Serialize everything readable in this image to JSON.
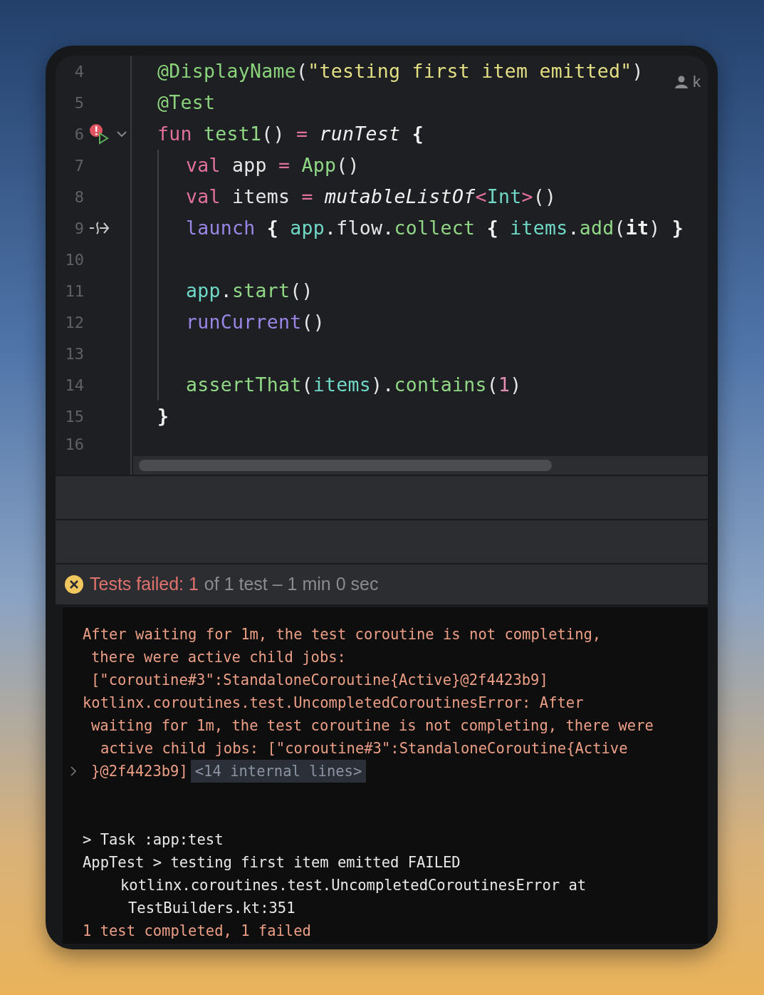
{
  "editor": {
    "author_hint": "k",
    "lines": [
      {
        "number": "4",
        "indented": false,
        "foldable": false,
        "tokens": [
          {
            "text": "@DisplayName",
            "kind": "annotation"
          },
          {
            "text": "(",
            "kind": "plain"
          },
          {
            "text": "\"testing first item emitted\"",
            "kind": "string"
          },
          {
            "text": ")",
            "kind": "plain"
          }
        ]
      },
      {
        "number": "5",
        "indented": false,
        "foldable": false,
        "tokens": [
          {
            "text": "@Test",
            "kind": "annotation"
          }
        ]
      },
      {
        "number": "6",
        "indented": false,
        "gutter_icon": {
          "kind": "failed_run"
        },
        "foldable": true,
        "tokens": [
          {
            "text": "fun ",
            "kind": "keyword"
          },
          {
            "text": "test1",
            "kind": "call"
          },
          {
            "text": "() ",
            "kind": "plain"
          },
          {
            "text": "= ",
            "kind": "keyword"
          },
          {
            "text": "runTest",
            "kind": "italic"
          },
          {
            "text": " {",
            "kind": "bold"
          }
        ]
      },
      {
        "number": "7",
        "indented": true,
        "foldable": false,
        "tokens": [
          {
            "text": "val ",
            "kind": "keyword"
          },
          {
            "text": "app ",
            "kind": "plain"
          },
          {
            "text": "= ",
            "kind": "keyword"
          },
          {
            "text": "App",
            "kind": "call"
          },
          {
            "text": "()",
            "kind": "plain"
          }
        ]
      },
      {
        "number": "8",
        "indented": true,
        "foldable": false,
        "tokens": [
          {
            "text": "val ",
            "kind": "keyword"
          },
          {
            "text": "items ",
            "kind": "plain"
          },
          {
            "text": "= ",
            "kind": "keyword"
          },
          {
            "text": "mutableListOf",
            "kind": "italic"
          },
          {
            "text": "<",
            "kind": "keyword"
          },
          {
            "text": "Int",
            "kind": "variable"
          },
          {
            "text": ">",
            "kind": "keyword"
          },
          {
            "text": "()",
            "kind": "plain"
          }
        ]
      },
      {
        "number": "9",
        "indented": true,
        "gutter_icon": {
          "kind": "suspend_call"
        },
        "foldable": false,
        "tokens": [
          {
            "text": "launch",
            "kind": "builtin"
          },
          {
            "text": " { ",
            "kind": "bold"
          },
          {
            "text": "app",
            "kind": "variable"
          },
          {
            "text": ".flow.",
            "kind": "plain"
          },
          {
            "text": "collect",
            "kind": "call"
          },
          {
            "text": " { ",
            "kind": "bold"
          },
          {
            "text": "items",
            "kind": "variable"
          },
          {
            "text": ".",
            "kind": "plain"
          },
          {
            "text": "add",
            "kind": "call"
          },
          {
            "text": "(",
            "kind": "plain"
          },
          {
            "text": "it",
            "kind": "bold"
          },
          {
            "text": ") ",
            "kind": "plain"
          },
          {
            "text": "}",
            "kind": "bold"
          }
        ]
      },
      {
        "number": "10",
        "indented": true,
        "foldable": false
      },
      {
        "number": "11",
        "indented": true,
        "foldable": false,
        "tokens": [
          {
            "text": "app",
            "kind": "variable"
          },
          {
            "text": ".",
            "kind": "plain"
          },
          {
            "text": "start",
            "kind": "call"
          },
          {
            "text": "()",
            "kind": "plain"
          }
        ]
      },
      {
        "number": "12",
        "indented": true,
        "foldable": false,
        "tokens": [
          {
            "text": "runCurrent",
            "kind": "builtin"
          },
          {
            "text": "()",
            "kind": "plain"
          }
        ]
      },
      {
        "number": "13",
        "indented": true,
        "foldable": false
      },
      {
        "number": "14",
        "indented": true,
        "foldable": false,
        "tokens": [
          {
            "text": "assertThat",
            "kind": "call"
          },
          {
            "text": "(",
            "kind": "plain"
          },
          {
            "text": "items",
            "kind": "variable"
          },
          {
            "text": ").",
            "kind": "plain"
          },
          {
            "text": "contains",
            "kind": "call"
          },
          {
            "text": "(",
            "kind": "plain"
          },
          {
            "text": "1",
            "kind": "number"
          },
          {
            "text": ")",
            "kind": "plain"
          }
        ]
      },
      {
        "number": "15",
        "indented": false,
        "foldable": false,
        "tokens": [
          {
            "text": "}",
            "kind": "bold"
          }
        ]
      },
      {
        "number": "16",
        "indented": false,
        "foldable": false
      }
    ]
  },
  "test_results": {
    "kind": "failed",
    "status_label": "Tests failed: 1",
    "detail": "of 1 test – 1 min 0 sec"
  },
  "console": {
    "lines": [
      {
        "text": "After waiting for 1m, the test coroutine is not completing,",
        "kind": "error"
      },
      {
        "text": "there were active child jobs:",
        "kind": "error_wrap"
      },
      {
        "text": "[\"coroutine#3\":StandaloneCoroutine{Active}@2f4423b9]",
        "kind": "error_wrap"
      },
      {
        "text": "kotlinx.coroutines.test.UncompletedCoroutinesError: After",
        "kind": "error"
      },
      {
        "text": "waiting for 1m, the test coroutine is not completing, there were",
        "kind": "error_wrap"
      },
      {
        "text": "active child jobs: [\"coroutine#3\":StandaloneCoroutine{Active",
        "kind": "error_wrap2"
      },
      {
        "text": "}@2f4423b9]",
        "kind": "error_wrap",
        "folded": "<14 internal lines>",
        "expanded": false
      },
      {
        "kind": "gap"
      },
      {
        "text": "> Task :app:test",
        "kind": "output"
      },
      {
        "text": "AppTest > testing first item emitted FAILED",
        "kind": "output"
      },
      {
        "text": "kotlinx.coroutines.test.UncompletedCoroutinesError at",
        "kind": "output_detail"
      },
      {
        "text": "TestBuilders.kt:351",
        "kind": "output_detail_wrap"
      },
      {
        "text": "1 test completed, 1 failed",
        "kind": "error"
      }
    ]
  }
}
